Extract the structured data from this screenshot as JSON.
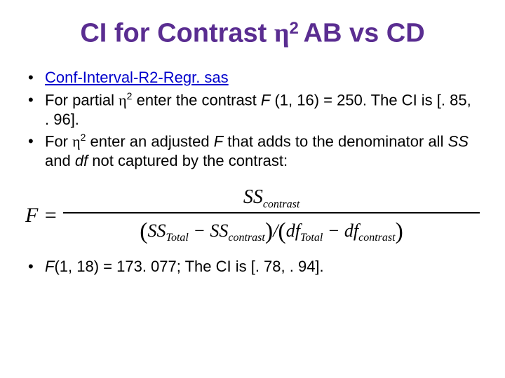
{
  "title": {
    "part1": "CI for Contrast ",
    "eta": "η",
    "exp": "2 ",
    "part2": "AB vs CD"
  },
  "bullets": {
    "b1_link": "Conf-Interval-R2-Regr. sas",
    "b2_a": "For partial ",
    "b2_eta": "η",
    "b2_exp": "2",
    "b2_b": " enter the contrast ",
    "b2_F": "F",
    "b2_c": " (1, 16) = 250. The CI is [. 85, . 96].",
    "b3_a": "For  ",
    "b3_eta": "η",
    "b3_exp": "2",
    "b3_b": " enter an adjusted ",
    "b3_F": "F",
    "b3_c": " that adds to the denominator all ",
    "b3_SS": "SS",
    "b3_d": " and ",
    "b3_df": "df",
    "b3_e": " not captured by the contrast:",
    "b4_F": "F",
    "b4_a": "(1, 18) = 173. 077; The CI is [. 78, . 94]."
  },
  "formula": {
    "lhs": "F = ",
    "num_SS": "SS",
    "num_sub": "contrast",
    "den_open1": "(",
    "den_SS1": "SS",
    "den_sub1": "Total",
    "den_minus1": " − ",
    "den_SS2": "SS",
    "den_sub2": "contrast",
    "den_close1": ")",
    "den_slash": "/",
    "den_open2": "(",
    "den_df1": "df",
    "den_sub3": "Total",
    "den_minus2": " − ",
    "den_df2": "df",
    "den_sub4": "contrast",
    "den_close2": ")"
  }
}
